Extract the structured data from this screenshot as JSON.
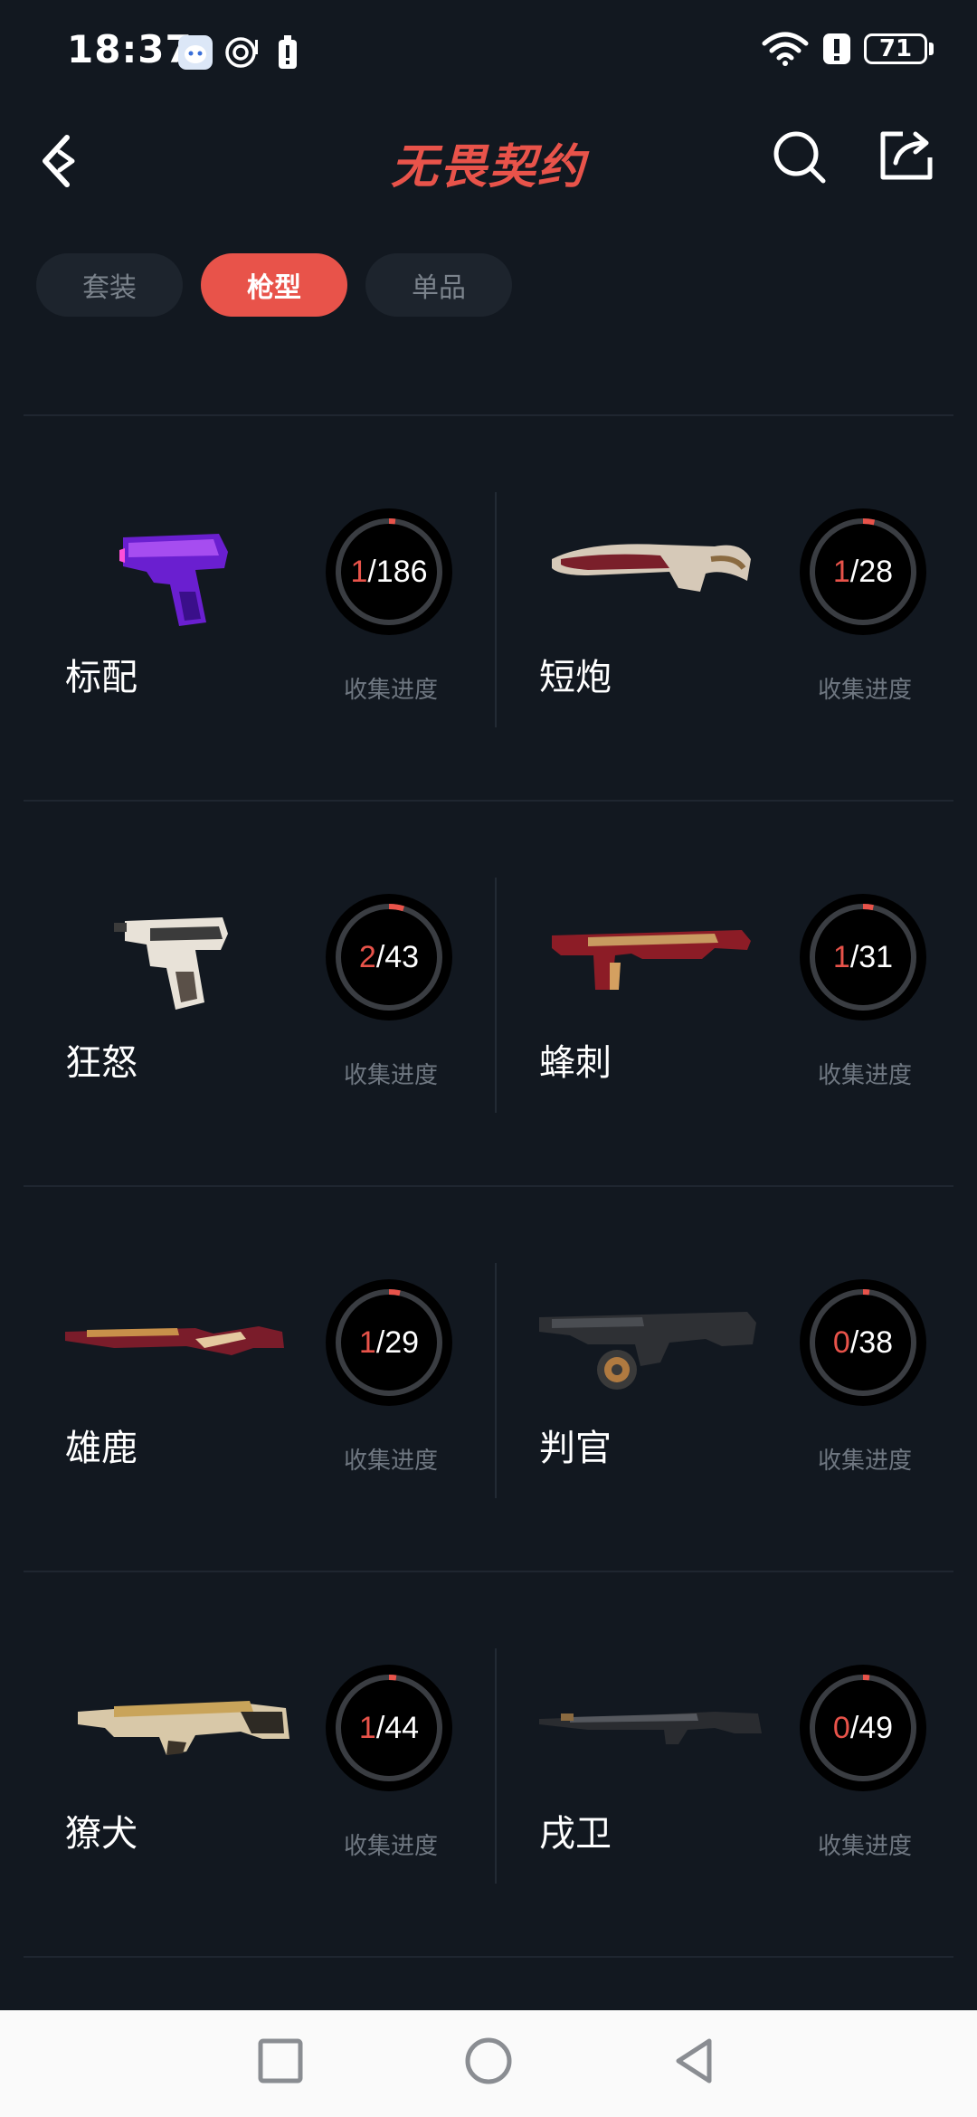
{
  "status_bar": {
    "time": "18:37",
    "battery": "71"
  },
  "header": {
    "title": "无畏契约"
  },
  "tabs": [
    {
      "label": "套装",
      "active": false
    },
    {
      "label": "枪型",
      "active": true
    },
    {
      "label": "单品",
      "active": false
    }
  ],
  "progress_label": "收集进度",
  "weapons": [
    {
      "name": "标配",
      "collected": "1",
      "total": "/186",
      "fraction": 0.0054
    },
    {
      "name": "短炮",
      "collected": "1",
      "total": "/28",
      "fraction": 0.0357
    },
    {
      "name": "狂怒",
      "collected": "2",
      "total": "/43",
      "fraction": 0.0465
    },
    {
      "name": "蜂刺",
      "collected": "1",
      "total": "/31",
      "fraction": 0.0323
    },
    {
      "name": "雄鹿",
      "collected": "1",
      "total": "/29",
      "fraction": 0.0345
    },
    {
      "name": "判官",
      "collected": "0",
      "total": "/38",
      "fraction": 0
    },
    {
      "name": "獠犬",
      "collected": "1",
      "total": "/44",
      "fraction": 0.0227
    },
    {
      "name": "戌卫",
      "collected": "0",
      "total": "/49",
      "fraction": 0
    }
  ],
  "colors": {
    "accent": "#e8534a",
    "background": "#121820"
  }
}
